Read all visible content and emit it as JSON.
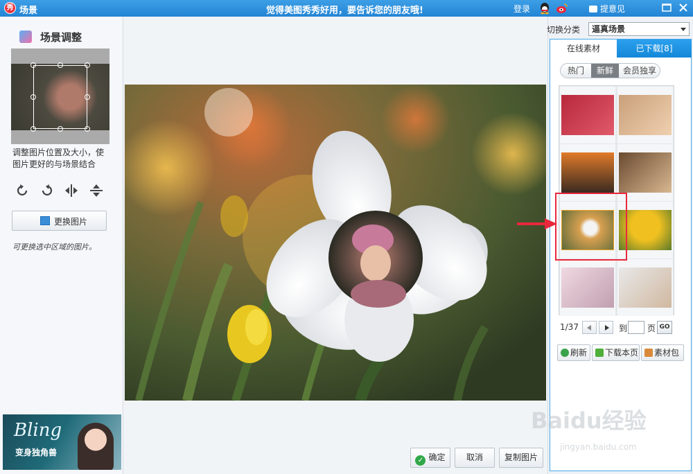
{
  "window": {
    "logo_char": "秀",
    "title": "场景",
    "slogan": "觉得美图秀秀好用，要告诉您的朋友哦!",
    "login": "登录",
    "feedback": "提意见"
  },
  "left": {
    "heading": "场景调整",
    "help_text": "调整图片位置及大小，使图片更好的与场景结合",
    "tools": [
      "rotate-left-icon",
      "rotate-right-icon",
      "flip-horizontal-icon",
      "flip-vertical-icon"
    ],
    "change_button": "更换图片",
    "hand_note": "可更换选中区域的图片。",
    "ad": {
      "title": "Bling",
      "subtitle": "变身独角兽"
    }
  },
  "actions": {
    "ok": "确定",
    "cancel": "取消",
    "copy": "复制图片"
  },
  "right": {
    "category_label": "切换分类",
    "category_value": "逼真场景",
    "tabs": [
      "在线素材",
      "已下载[8]"
    ],
    "subtabs": [
      "热门",
      "新鲜",
      "会员独享"
    ],
    "active_subtab": "新鲜",
    "thumbnails": [
      {
        "name": "hearts-red",
        "colors": [
          "#b8283c",
          "#e05a6a"
        ]
      },
      {
        "name": "heart-hands",
        "colors": [
          "#c9a07a",
          "#f0d0b0"
        ]
      },
      {
        "name": "sunset-hands",
        "colors": [
          "#e07a2a",
          "#3a2a20"
        ]
      },
      {
        "name": "coffee-cup",
        "colors": [
          "#6a4a30",
          "#d8b890"
        ]
      },
      {
        "name": "daffodil",
        "colors": [
          "#d8a050",
          "#5a6a3a"
        ]
      },
      {
        "name": "sunflowers",
        "colors": [
          "#f0c020",
          "#5a7a2a"
        ]
      },
      {
        "name": "pink-room",
        "colors": [
          "#f0d8e0",
          "#c0a0b0"
        ]
      },
      {
        "name": "paper-cup",
        "colors": [
          "#e8e8e8",
          "#d0b8a0"
        ]
      }
    ],
    "pager": {
      "current": "1/37",
      "to_label": "到",
      "page_input": "",
      "page_label": "页",
      "go": "GO"
    },
    "buttons": {
      "refresh": "刷新",
      "download": "下载本页",
      "pack": "素材包"
    }
  },
  "watermark": {
    "text": "Baidu经验",
    "url": "jingyan.baidu.com"
  },
  "colors": {
    "titlebar": "#2384d4",
    "accent_tab": "#1488d8",
    "highlight": "#e8283c"
  }
}
